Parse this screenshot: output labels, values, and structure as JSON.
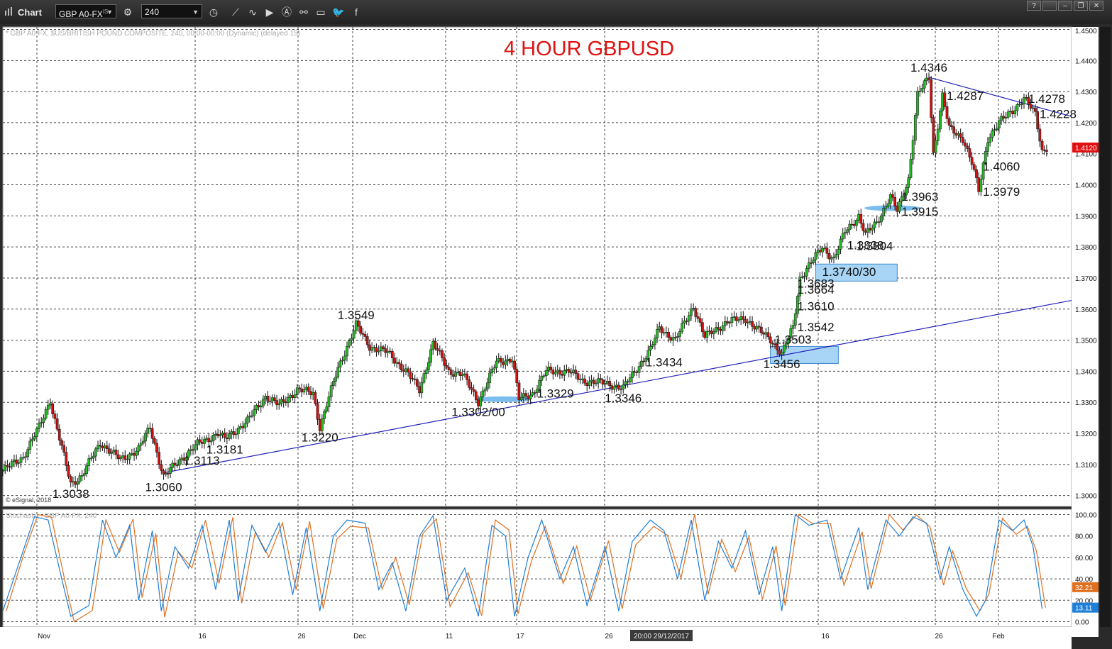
{
  "app": {
    "title": "Chart"
  },
  "toolbar": {
    "symbol": "GBP A0-FX",
    "symbol_sup": "IS",
    "interval": "240",
    "buttons": [
      {
        "name": "settings-icon",
        "glyph": "⚙"
      },
      {
        "name": "clock-icon",
        "glyph": "◷"
      },
      {
        "name": "draw-line-icon",
        "glyph": "⟋"
      },
      {
        "name": "squiggle-icon",
        "glyph": "∿"
      },
      {
        "name": "play-icon",
        "glyph": "▶"
      },
      {
        "name": "alert-icon",
        "glyph": "Ⓐ"
      },
      {
        "name": "link-icon",
        "glyph": "⚯"
      },
      {
        "name": "comment-icon",
        "glyph": "▭"
      },
      {
        "name": "twitter-icon",
        "glyph": "🐦"
      },
      {
        "name": "facebook-icon",
        "glyph": "f"
      }
    ],
    "window_buttons": [
      {
        "name": "help-button",
        "glyph": "?"
      },
      {
        "name": "blank-button",
        "glyph": ""
      },
      {
        "name": "minimize-button",
        "glyph": "–"
      },
      {
        "name": "restore-button",
        "glyph": "❐"
      },
      {
        "name": "close-button",
        "glyph": "✕"
      }
    ]
  },
  "chart_data": {
    "type": "candlestick",
    "title": "4 HOUR GBPUSD",
    "header_info": "* GBP A0-FX, $US/BRITISH POUND COMPOSITE, 240, 00:00-00:00 (Dynamic) (delayed 15)",
    "watermark": "© eSignal, 2018",
    "y_ticks": [
      "1.4500",
      "1.4400",
      "1.4300",
      "1.4200",
      "1.4100",
      "1.4000",
      "1.3900",
      "1.3800",
      "1.3700",
      "1.3600",
      "1.3500",
      "1.3400",
      "1.3300",
      "1.3200",
      "1.3100",
      "1.3000"
    ],
    "ylim": [
      1.2965,
      1.4508
    ],
    "last_price": "1.4120",
    "x_labels": [
      "Nov",
      "16",
      "26",
      "Dec",
      "11",
      "17",
      "26",
      "16",
      "26",
      "Feb"
    ],
    "x_tooltip": "20:00 29/12/2017",
    "grid": true,
    "path": [
      [
        0,
        1.308
      ],
      [
        9,
        1.3125
      ],
      [
        16,
        1.322
      ],
      [
        21,
        1.331
      ],
      [
        22,
        1.327
      ],
      [
        30,
        1.3038
      ],
      [
        35,
        1.3065
      ],
      [
        43,
        1.317
      ],
      [
        52,
        1.3115
      ],
      [
        60,
        1.315
      ],
      [
        65,
        1.322
      ],
      [
        71,
        1.306
      ],
      [
        78,
        1.3113
      ],
      [
        86,
        1.3165
      ],
      [
        95,
        1.32
      ],
      [
        98,
        1.3181
      ],
      [
        108,
        1.324
      ],
      [
        116,
        1.332
      ],
      [
        122,
        1.329
      ],
      [
        130,
        1.334
      ],
      [
        137,
        1.333
      ],
      [
        140,
        1.322
      ],
      [
        148,
        1.341
      ],
      [
        156,
        1.3549
      ],
      [
        162,
        1.348
      ],
      [
        170,
        1.346
      ],
      [
        178,
        1.34
      ],
      [
        184,
        1.334
      ],
      [
        190,
        1.349
      ],
      [
        197,
        1.34
      ],
      [
        203,
        1.339
      ],
      [
        210,
        1.3302
      ],
      [
        218,
        1.343
      ],
      [
        225,
        1.344
      ],
      [
        228,
        1.331
      ],
      [
        234,
        1.3329
      ],
      [
        240,
        1.34
      ],
      [
        250,
        1.34
      ],
      [
        256,
        1.337
      ],
      [
        267,
        1.336
      ],
      [
        274,
        1.3346
      ],
      [
        282,
        1.343
      ],
      [
        286,
        1.347
      ],
      [
        290,
        1.354
      ],
      [
        297,
        1.35
      ],
      [
        305,
        1.361
      ],
      [
        310,
        1.351
      ],
      [
        320,
        1.356
      ],
      [
        328,
        1.357
      ],
      [
        334,
        1.353
      ],
      [
        339,
        1.3503
      ],
      [
        344,
        1.3456
      ],
      [
        349,
        1.3542
      ],
      [
        352,
        1.37
      ],
      [
        356,
        1.374
      ],
      [
        362,
        1.38
      ],
      [
        367,
        1.376
      ],
      [
        372,
        1.385
      ],
      [
        378,
        1.39
      ],
      [
        381,
        1.3838
      ],
      [
        386,
        1.388
      ],
      [
        392,
        1.3963
      ],
      [
        395,
        1.3915
      ],
      [
        400,
        1.402
      ],
      [
        404,
        1.429
      ],
      [
        409,
        1.4346
      ],
      [
        411,
        1.41
      ],
      [
        415,
        1.4287
      ],
      [
        418,
        1.418
      ],
      [
        424,
        1.415
      ],
      [
        428,
        1.407
      ],
      [
        431,
        1.3979
      ],
      [
        435,
        1.415
      ],
      [
        440,
        1.42
      ],
      [
        446,
        1.424
      ],
      [
        451,
        1.4278
      ],
      [
        456,
        1.4228
      ],
      [
        459,
        1.411
      ],
      [
        461,
        1.412
      ]
    ],
    "annotations": [
      {
        "text": "1.3038",
        "x": 30,
        "y": 1.3038,
        "pos": "below"
      },
      {
        "text": "1.3060",
        "x": 71,
        "y": 1.306,
        "pos": "below"
      },
      {
        "text": "1.3113",
        "x": 78,
        "y": 1.3113,
        "pos": "right"
      },
      {
        "text": "1.3181",
        "x": 98,
        "y": 1.3181,
        "pos": "below"
      },
      {
        "text": "1.3220",
        "x": 140,
        "y": 1.322,
        "pos": "below"
      },
      {
        "text": "1.3549",
        "x": 156,
        "y": 1.3549,
        "pos": "above"
      },
      {
        "text": "1.3302/00",
        "x": 210,
        "y": 1.3302,
        "pos": "below"
      },
      {
        "text": "1.3329",
        "x": 234,
        "y": 1.3329,
        "pos": "right"
      },
      {
        "text": "1.3346",
        "x": 274,
        "y": 1.3346,
        "pos": "below"
      },
      {
        "text": "1.3434",
        "x": 282,
        "y": 1.343,
        "pos": "right"
      },
      {
        "text": "1.3456",
        "x": 344,
        "y": 1.3456,
        "pos": "below"
      },
      {
        "text": "1.3503",
        "x": 339,
        "y": 1.3503,
        "pos": "right"
      },
      {
        "text": "1.3542",
        "x": 349,
        "y": 1.3542,
        "pos": "right"
      },
      {
        "text": "1.3610",
        "x": 349,
        "y": 1.361,
        "pos": "right"
      },
      {
        "text": "1.3664",
        "x": 349,
        "y": 1.3664,
        "pos": "right"
      },
      {
        "text": "1.3683",
        "x": 349,
        "y": 1.3683,
        "pos": "right"
      },
      {
        "text": "1.3740/30",
        "x": 360,
        "y": 1.372,
        "pos": "right"
      },
      {
        "text": "1.3804",
        "x": 375,
        "y": 1.3804,
        "pos": "right"
      },
      {
        "text": "1.3838",
        "x": 381,
        "y": 1.3838,
        "pos": "below"
      },
      {
        "text": "1.3915",
        "x": 395,
        "y": 1.3915,
        "pos": "right"
      },
      {
        "text": "1.3963",
        "x": 395,
        "y": 1.3963,
        "pos": "right"
      },
      {
        "text": "1.4346",
        "x": 409,
        "y": 1.4346,
        "pos": "above"
      },
      {
        "text": "1.4287",
        "x": 415,
        "y": 1.4287,
        "pos": "right"
      },
      {
        "text": "1.3979",
        "x": 431,
        "y": 1.3979,
        "pos": "right"
      },
      {
        "text": "1.4060",
        "x": 431,
        "y": 1.406,
        "pos": "right"
      },
      {
        "text": "1.4278",
        "x": 451,
        "y": 1.4278,
        "pos": "right"
      },
      {
        "text": "1.4228",
        "x": 456,
        "y": 1.4228,
        "pos": "right"
      }
    ],
    "trendlines": [
      {
        "x1": 71,
        "y1": 1.3073,
        "x2": 472,
        "y2": 1.3628,
        "color": "#2222bb"
      },
      {
        "x1": 409,
        "y1": 1.4346,
        "x2": 472,
        "y2": 1.422,
        "color": "#2222bb"
      }
    ],
    "highlight_boxes": [
      {
        "x1": 339,
        "y1": 1.3425,
        "x2": 369,
        "y2": 1.348
      },
      {
        "x1": 359,
        "y1": 1.369,
        "x2": 395,
        "y2": 1.3745
      }
    ],
    "highlight_ellipses": [
      {
        "cx": 221,
        "cy": 1.331
      },
      {
        "cx": 393,
        "cy": 1.3925
      }
    ],
    "stochastic": {
      "label": "Stochastic . GBP A0-FX, 240",
      "y_ticks": [
        "100.00",
        "80.00",
        "60.00",
        "40.00",
        "20.00",
        "0.00"
      ],
      "ylim": [
        -5,
        105
      ],
      "last_k": "13.11",
      "last_d": "32.21",
      "k_color": "#1e7fd8",
      "d_color": "#e07020",
      "points": [
        [
          0,
          10
        ],
        [
          8,
          60
        ],
        [
          14,
          98
        ],
        [
          20,
          95
        ],
        [
          26,
          40
        ],
        [
          30,
          5
        ],
        [
          38,
          15
        ],
        [
          44,
          95
        ],
        [
          50,
          60
        ],
        [
          56,
          90
        ],
        [
          60,
          20
        ],
        [
          66,
          85
        ],
        [
          70,
          10
        ],
        [
          76,
          70
        ],
        [
          82,
          50
        ],
        [
          88,
          90
        ],
        [
          94,
          30
        ],
        [
          100,
          95
        ],
        [
          104,
          20
        ],
        [
          110,
          90
        ],
        [
          116,
          65
        ],
        [
          122,
          92
        ],
        [
          128,
          25
        ],
        [
          134,
          88
        ],
        [
          140,
          10
        ],
        [
          146,
          80
        ],
        [
          152,
          95
        ],
        [
          160,
          92
        ],
        [
          166,
          30
        ],
        [
          172,
          55
        ],
        [
          178,
          10
        ],
        [
          184,
          80
        ],
        [
          190,
          99
        ],
        [
          196,
          20
        ],
        [
          204,
          50
        ],
        [
          210,
          5
        ],
        [
          216,
          90
        ],
        [
          222,
          80
        ],
        [
          226,
          5
        ],
        [
          232,
          60
        ],
        [
          238,
          95
        ],
        [
          246,
          40
        ],
        [
          252,
          70
        ],
        [
          258,
          15
        ],
        [
          266,
          70
        ],
        [
          272,
          10
        ],
        [
          278,
          75
        ],
        [
          286,
          95
        ],
        [
          292,
          85
        ],
        [
          298,
          40
        ],
        [
          304,
          95
        ],
        [
          310,
          20
        ],
        [
          316,
          75
        ],
        [
          322,
          50
        ],
        [
          328,
          85
        ],
        [
          334,
          25
        ],
        [
          340,
          70
        ],
        [
          344,
          10
        ],
        [
          350,
          100
        ],
        [
          356,
          90
        ],
        [
          364,
          95
        ],
        [
          370,
          40
        ],
        [
          378,
          88
        ],
        [
          382,
          30
        ],
        [
          390,
          95
        ],
        [
          396,
          80
        ],
        [
          402,
          98
        ],
        [
          408,
          92
        ],
        [
          414,
          40
        ],
        [
          418,
          70
        ],
        [
          424,
          30
        ],
        [
          430,
          5
        ],
        [
          434,
          20
        ],
        [
          440,
          95
        ],
        [
          446,
          85
        ],
        [
          451,
          95
        ],
        [
          455,
          70
        ],
        [
          459,
          12
        ]
      ]
    }
  }
}
